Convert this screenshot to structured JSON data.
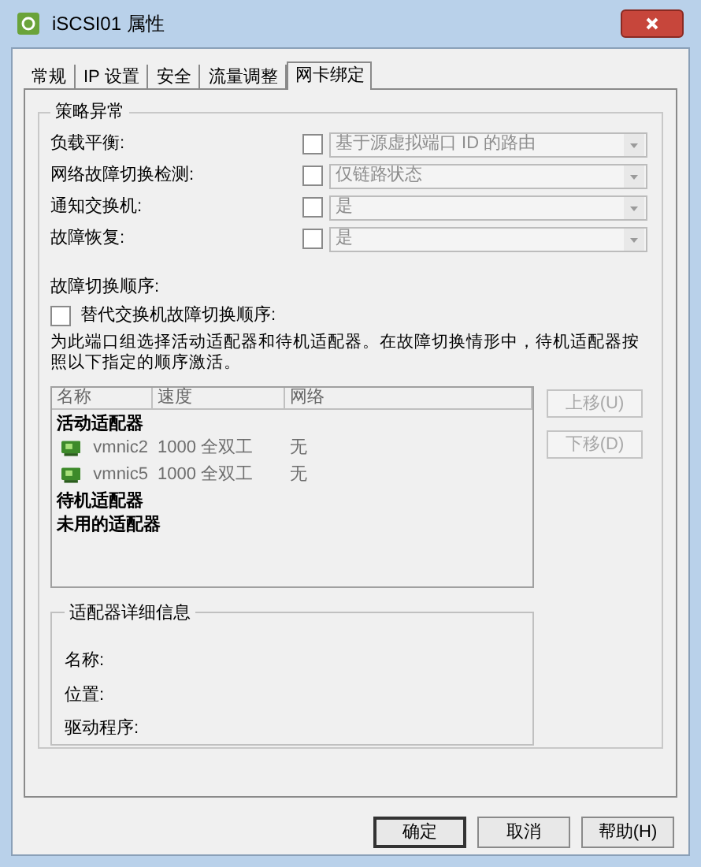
{
  "window": {
    "title": "iSCSI01 属性"
  },
  "tabs": [
    {
      "label": "常规",
      "selected": false
    },
    {
      "label": "IP 设置",
      "selected": false
    },
    {
      "label": "安全",
      "selected": false
    },
    {
      "label": "流量调整",
      "selected": false
    },
    {
      "label": "网卡绑定",
      "selected": true
    }
  ],
  "policy": {
    "title": "策略异常",
    "rows": [
      {
        "label": "负载平衡:",
        "checked": false,
        "value": "基于源虚拟端口 ID 的路由",
        "disabled": true
      },
      {
        "label": "网络故障切换检测:",
        "checked": false,
        "value": "仅链路状态",
        "disabled": true
      },
      {
        "label": "通知交换机:",
        "checked": false,
        "value": "是",
        "disabled": true
      },
      {
        "label": "故障恢复:",
        "checked": false,
        "value": "是",
        "disabled": true
      }
    ]
  },
  "failover": {
    "title": "故障切换顺序:",
    "override": {
      "label": "替代交换机故障切换顺序:",
      "checked": false
    },
    "description": "为此端口组选择活动适配器和待机适配器。在故障切换情形中，待机适配器按照以下指定的顺序激活。"
  },
  "adapter_list": {
    "columns": [
      "名称",
      "速度",
      "网络"
    ],
    "groups": [
      {
        "label": "活动适配器",
        "adapters": [
          {
            "name": "vmnic2",
            "speed": "1000 全双工",
            "network": "无"
          },
          {
            "name": "vmnic5",
            "speed": "1000 全双工",
            "network": "无"
          }
        ]
      },
      {
        "label": "待机适配器"
      },
      {
        "label": "未用的适配器"
      }
    ]
  },
  "move_buttons": [
    {
      "label": "上移(U)",
      "disabled": true
    },
    {
      "label": "下移(D)",
      "disabled": true
    }
  ],
  "details": {
    "title": "适配器详细信息",
    "fields": [
      "名称:",
      "位置:",
      "驱动程序:"
    ]
  },
  "buttons": [
    {
      "label": "确定",
      "default": true
    },
    {
      "label": "取消",
      "default": false
    },
    {
      "label": "帮助(H)",
      "default": false
    }
  ]
}
